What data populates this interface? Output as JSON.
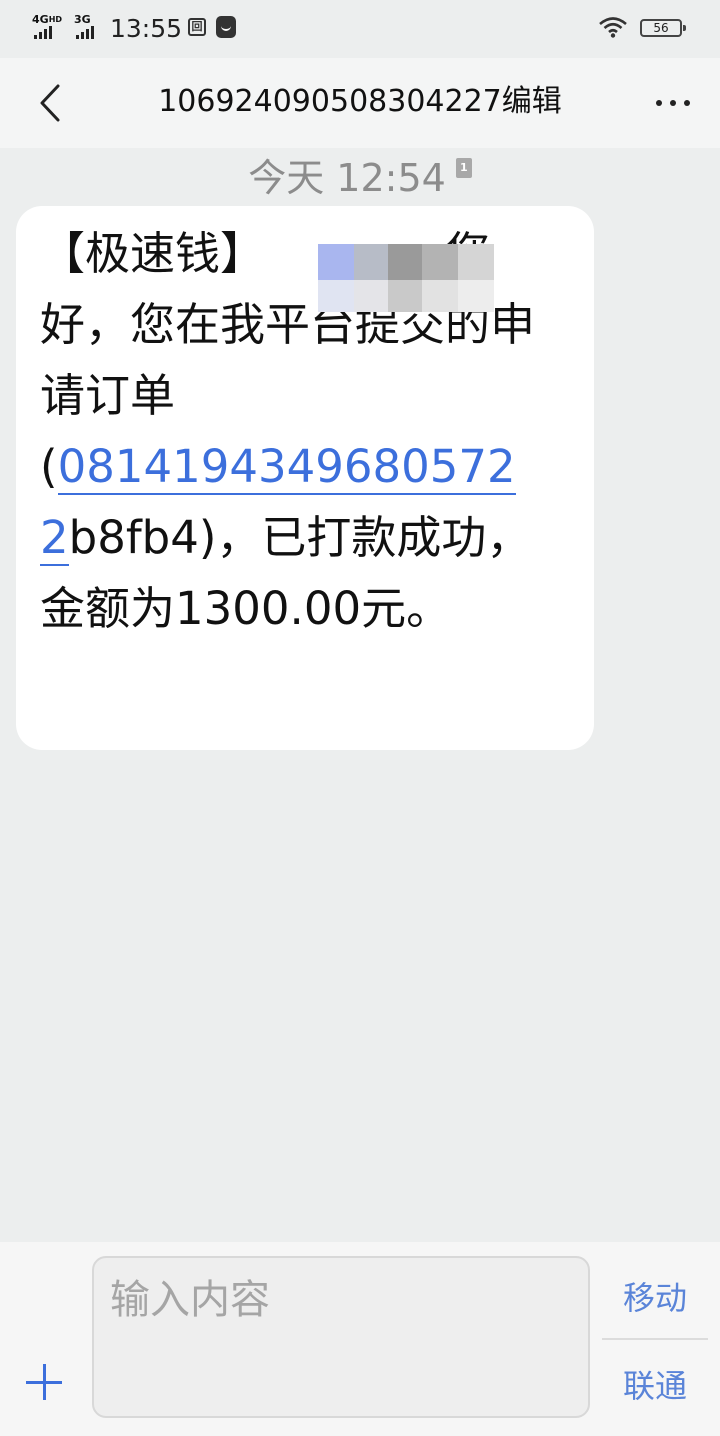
{
  "status_bar": {
    "network1": "4G",
    "network1_sup": "HD",
    "network2": "3G",
    "time": "13:55",
    "battery": "56"
  },
  "header": {
    "title": "1069240905083042​27编辑"
  },
  "conversation": {
    "date_label": "今天 12:54",
    "sim_badge": "1",
    "message": {
      "prefix": "【极速钱】",
      "line_after_blur": "您好，您在我平台提交的申请订单(",
      "order_link": "0814194349680572​2",
      "after_link": "b8fb4)，已打款成功，金额为1300.00元。"
    }
  },
  "composer": {
    "placeholder": "输入内容",
    "send_sim1": "移动",
    "send_sim2": "联通"
  }
}
